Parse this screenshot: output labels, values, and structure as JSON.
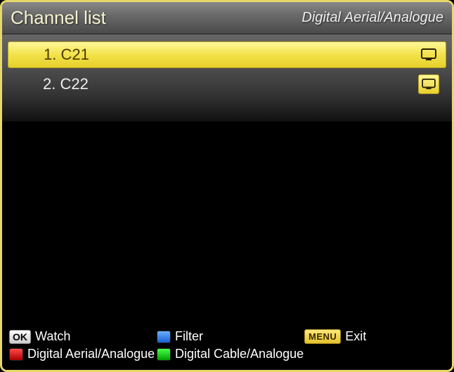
{
  "header": {
    "title": "Channel list",
    "subtitle": "Digital Aerial/Analogue"
  },
  "channels": [
    {
      "label": "1. C21",
      "selected": true,
      "icon_boxed": false
    },
    {
      "label": "2. C22",
      "selected": false,
      "icon_boxed": true
    }
  ],
  "footer": {
    "ok": {
      "key": "OK",
      "label": "Watch"
    },
    "blue": {
      "label": "Filter"
    },
    "menu": {
      "key": "MENU",
      "label": "Exit"
    },
    "red": {
      "label": "Digital Aerial/Analogue"
    },
    "green": {
      "label": "Digital Cable/Analogue"
    }
  }
}
